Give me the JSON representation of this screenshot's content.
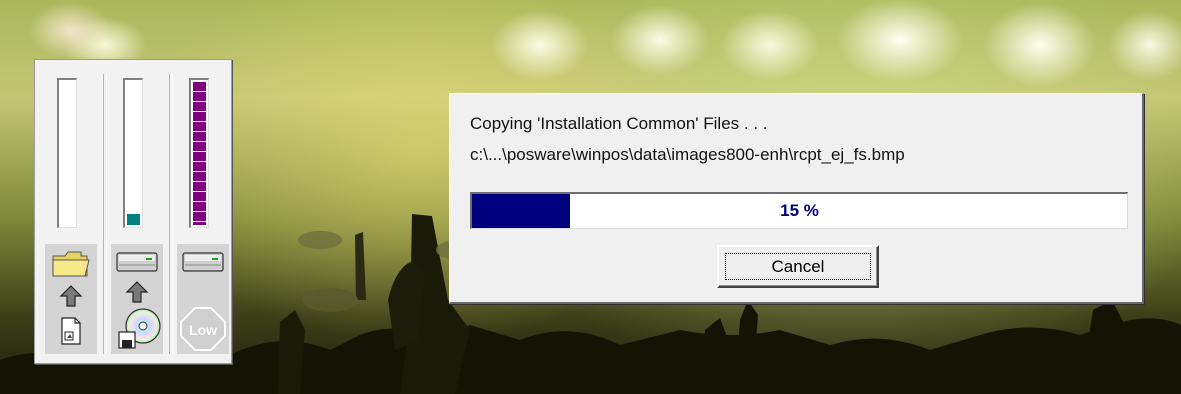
{
  "dialog": {
    "status_line": "Copying 'Installation Common' Files . . .",
    "file_path": "c:\\...\\posware\\winpos\\data\\images800-enh\\rcpt_ej_fs.bmp",
    "progress_percent": 15,
    "progress_label": "15 %",
    "progress_color": "#00007f",
    "cancel_label": "Cancel"
  },
  "monitor": {
    "meters": [
      {
        "name": "source",
        "fill_fraction": 0.0,
        "color": "#ffffff",
        "style": "solid"
      },
      {
        "name": "destination",
        "fill_fraction": 0.08,
        "color": "#008080",
        "style": "solid"
      },
      {
        "name": "memory",
        "fill_fraction": 1.0,
        "color": "#800080",
        "style": "segmented"
      }
    ],
    "low_badge_text": "Low",
    "icons": [
      "folder-icon",
      "up-arrow-icon",
      "document-icon",
      "drive-icon",
      "up-arrow-icon",
      "cd-disk-icon",
      "drive-icon",
      "low-stop-icon"
    ]
  }
}
